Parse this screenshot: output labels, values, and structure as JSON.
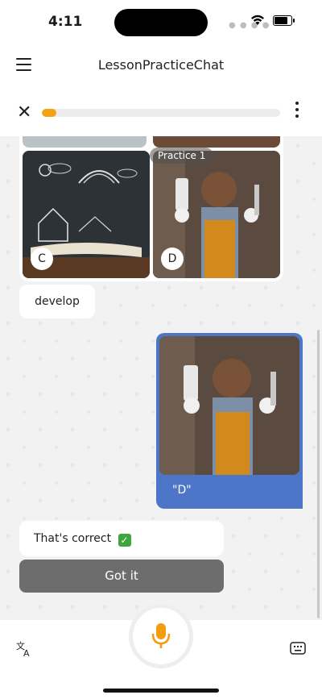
{
  "status": {
    "time": "4:11"
  },
  "header": {
    "title": "LessonPracticeChat"
  },
  "progress": {
    "value": 0.06,
    "color": "#f3a217"
  },
  "chat": {
    "practice_label": "Practice 1",
    "options": [
      "C",
      "D"
    ],
    "messages": {
      "left_word": "develop",
      "right_answer": "\"D\"",
      "feedback": "That's correct"
    },
    "button": "Got it"
  },
  "colors": {
    "accent": "#4d76c8",
    "button_gray": "#6d6d6d",
    "mic": "#f39c12"
  },
  "icons": {
    "menu": "hamburger-icon",
    "close": "close-icon",
    "more": "more-vertical-icon",
    "translate": "translate-icon",
    "mic": "microphone-icon",
    "keyboard": "keyboard-icon",
    "check": "check-mark-icon"
  }
}
